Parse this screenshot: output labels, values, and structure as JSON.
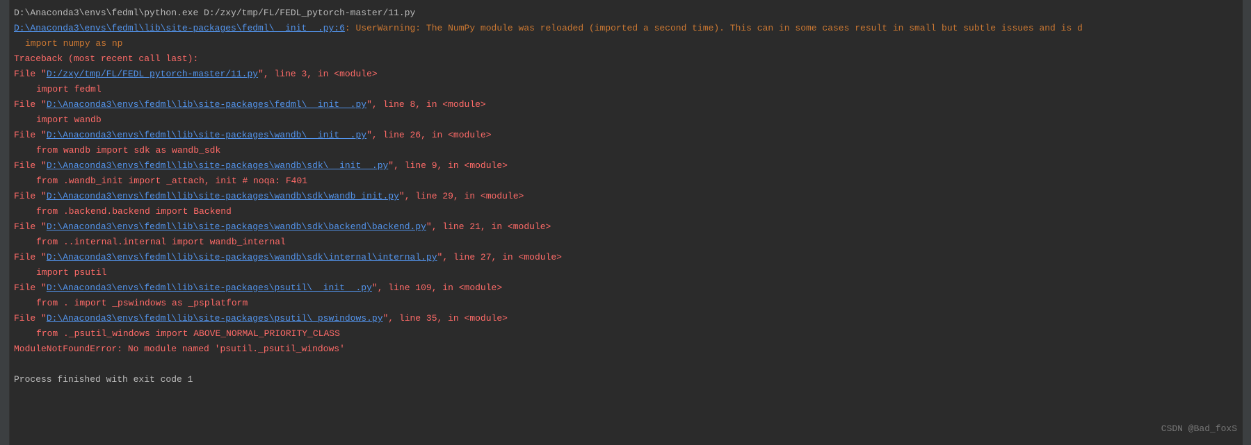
{
  "console": {
    "command": "D:\\Anaconda3\\envs\\fedml\\python.exe D:/zxy/tmp/FL/FEDL_pytorch-master/11.py",
    "warningLink": "D:\\Anaconda3\\envs\\fedml\\lib\\site-packages\\fedml\\__init__.py:6",
    "warningText": ": UserWarning: The NumPy module was reloaded (imported a second time). This can in some cases result in small but subtle issues and is d",
    "importNumpy": "import numpy as np",
    "tracebackHeader": "Traceback (most recent call last):",
    "frames": [
      {
        "prefix": "  File \"",
        "path": "D:/zxy/tmp/FL/FEDL_pytorch-master/11.py",
        "suffix": "\", line 3, in <module>",
        "code": "import fedml"
      },
      {
        "prefix": "  File \"",
        "path": "D:\\Anaconda3\\envs\\fedml\\lib\\site-packages\\fedml\\__init__.py",
        "suffix": "\", line 8, in <module>",
        "code": "import wandb"
      },
      {
        "prefix": "  File \"",
        "path": "D:\\Anaconda3\\envs\\fedml\\lib\\site-packages\\wandb\\__init__.py",
        "suffix": "\", line 26, in <module>",
        "code": "from wandb import sdk as wandb_sdk"
      },
      {
        "prefix": "  File \"",
        "path": "D:\\Anaconda3\\envs\\fedml\\lib\\site-packages\\wandb\\sdk\\__init__.py",
        "suffix": "\", line 9, in <module>",
        "code": "from .wandb_init import _attach, init  # noqa: F401"
      },
      {
        "prefix": "  File \"",
        "path": "D:\\Anaconda3\\envs\\fedml\\lib\\site-packages\\wandb\\sdk\\wandb_init.py",
        "suffix": "\", line 29, in <module>",
        "code": "from .backend.backend import Backend"
      },
      {
        "prefix": "  File \"",
        "path": "D:\\Anaconda3\\envs\\fedml\\lib\\site-packages\\wandb\\sdk\\backend\\backend.py",
        "suffix": "\", line 21, in <module>",
        "code": "from ..internal.internal import wandb_internal"
      },
      {
        "prefix": "  File \"",
        "path": "D:\\Anaconda3\\envs\\fedml\\lib\\site-packages\\wandb\\sdk\\internal\\internal.py",
        "suffix": "\", line 27, in <module>",
        "code": "import psutil"
      },
      {
        "prefix": "  File \"",
        "path": "D:\\Anaconda3\\envs\\fedml\\lib\\site-packages\\psutil\\__init__.py",
        "suffix": "\", line 109, in <module>",
        "code": "from . import _pswindows as _psplatform"
      },
      {
        "prefix": "  File \"",
        "path": "D:\\Anaconda3\\envs\\fedml\\lib\\site-packages\\psutil\\_pswindows.py",
        "suffix": "\", line 35, in <module>",
        "code": "from ._psutil_windows import ABOVE_NORMAL_PRIORITY_CLASS"
      }
    ],
    "errorLine": "ModuleNotFoundError: No module named 'psutil._psutil_windows'",
    "processExit": "Process finished with exit code 1"
  },
  "watermark": "CSDN @Bad_foxS"
}
